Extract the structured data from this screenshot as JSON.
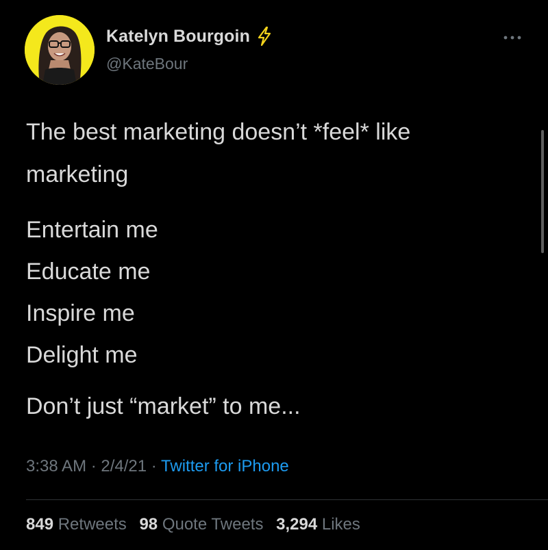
{
  "author": {
    "display_name": "Katelyn Bourgoin",
    "handle": "@KateBour",
    "avatar_bg": "#f4e81c",
    "badge_icon": "lightning-bolt-icon"
  },
  "tweet": {
    "paragraph1_line1": "The best marketing doesn’t *feel* like",
    "paragraph1_line2": "marketing",
    "list_lines": [
      "Entertain me",
      "Educate me",
      "Inspire me",
      "Delight me"
    ],
    "closing": "Don’t just “market” to me..."
  },
  "meta": {
    "time": "3:38 AM",
    "separator1": " · ",
    "date": "2/4/21",
    "separator2": " · ",
    "source": "Twitter for iPhone"
  },
  "stats": {
    "retweets_count": "849",
    "retweets_label": "Retweets",
    "quotes_count": "98",
    "quotes_label": "Quote Tweets",
    "likes_count": "3,294",
    "likes_label": "Likes"
  },
  "colors": {
    "background": "#000000",
    "text": "#d9d9d9",
    "secondary": "#6e767d",
    "link": "#1d9bf0",
    "bolt": "#f4d31c"
  }
}
